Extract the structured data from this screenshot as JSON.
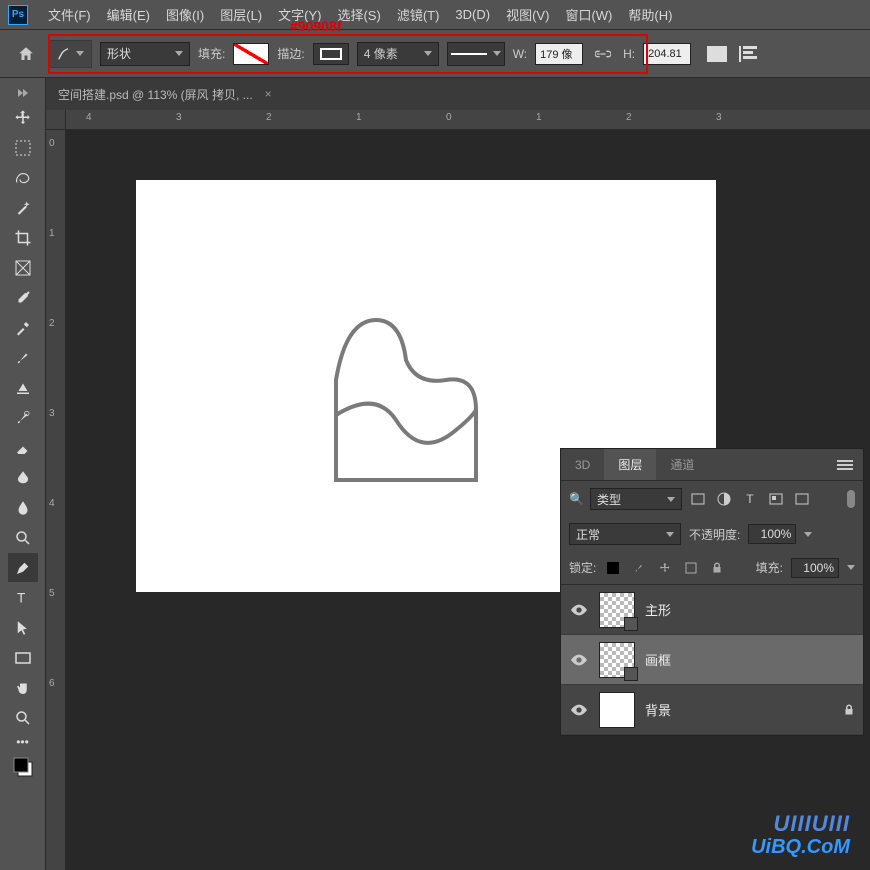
{
  "app": {
    "logo_text": "Ps"
  },
  "menu": {
    "items": [
      "文件(F)",
      "编辑(E)",
      "图像(I)",
      "图层(L)",
      "文字(Y)",
      "选择(S)",
      "滤镜(T)",
      "3D(D)",
      "视图(V)",
      "窗口(W)",
      "帮助(H)"
    ]
  },
  "annotation": {
    "color_label": "#90908f"
  },
  "options": {
    "mode": "形状",
    "fill_label": "填充:",
    "stroke_label": "描边:",
    "stroke_width": "4 像素",
    "w_label": "W:",
    "h_label": "H:",
    "w_value": "179 像",
    "h_value": "204.81"
  },
  "document": {
    "tab_title": "空间搭建.psd @ 113% (屏风 拷贝, ...",
    "close_glyph": "×"
  },
  "rulers": {
    "h": [
      "4",
      "3",
      "2",
      "1",
      "0",
      "1",
      "2",
      "3"
    ],
    "v": [
      "0",
      "1",
      "2",
      "3",
      "4",
      "5",
      "6"
    ]
  },
  "panels": {
    "tabs": [
      "3D",
      "图层",
      "通道"
    ],
    "filter_label": "类型",
    "search_glyph": "🔍",
    "blend_mode": "正常",
    "opacity_label": "不透明度:",
    "opacity_value": "100%",
    "lock_label": "锁定:",
    "fill_label": "填充:",
    "fill_value": "100%",
    "layers": [
      {
        "name": "主形",
        "locked": false,
        "selected": false
      },
      {
        "name": "画框",
        "locked": false,
        "selected": true
      },
      {
        "name": "背景",
        "locked": true,
        "selected": false
      }
    ]
  },
  "watermark": {
    "line1": "UIIIUIII",
    "line2": "UiBQ.CoM"
  }
}
